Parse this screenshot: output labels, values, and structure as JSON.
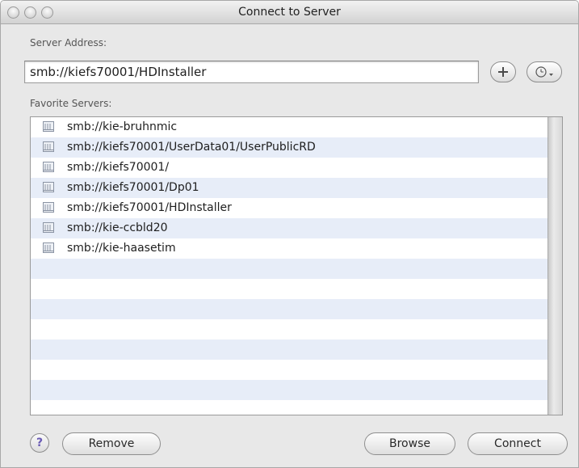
{
  "window": {
    "title": "Connect to Server"
  },
  "server_address": {
    "label": "Server Address:",
    "value": "smb://kiefs70001/HDInstaller"
  },
  "favorites": {
    "label": "Favorite Servers:",
    "items": [
      "smb://kie-bruhnmic",
      "smb://kiefs70001/UserData01/UserPublicRD",
      "smb://kiefs70001/",
      "smb://kiefs70001/Dp01",
      "smb://kiefs70001/HDInstaller",
      "smb://kie-ccbld20",
      "smb://kie-haasetim"
    ]
  },
  "buttons": {
    "help": "?",
    "remove": "Remove",
    "browse": "Browse",
    "connect": "Connect"
  },
  "icons": {
    "add": "plus-icon",
    "recent": "clock-dropdown-icon",
    "server": "server-icon",
    "help": "question-mark-icon"
  },
  "colors": {
    "row_alt": "#e7edf8",
    "help_mark": "#6a5bb5"
  }
}
